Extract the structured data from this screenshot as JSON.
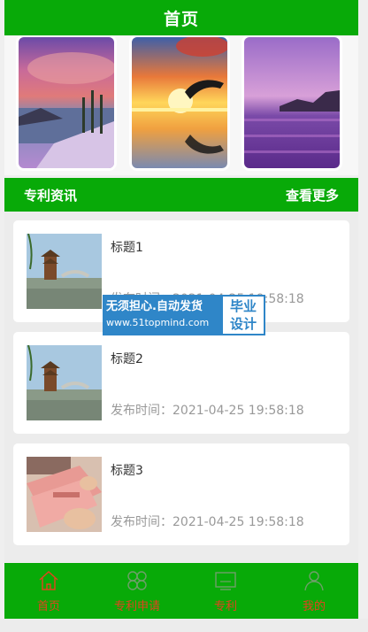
{
  "header": {
    "title": "首页"
  },
  "carousel": {
    "slides": [
      "sunset-lake-image",
      "dolphin-sunset-image",
      "purple-sea-image"
    ]
  },
  "section": {
    "title": "专利资讯",
    "more_label": "查看更多"
  },
  "articles": [
    {
      "title": "标题1",
      "time": "发布时间：2021-04-25 19:58:18",
      "thumb": "pagoda-image"
    },
    {
      "title": "标题2",
      "time": "发布时间：2021-04-25 19:58:18",
      "thumb": "pagoda-image"
    },
    {
      "title": "标题3",
      "time": "发布时间：2021-04-25 19:58:18",
      "thumb": "money-image"
    }
  ],
  "watermark": {
    "line1": "无须担心.自动发货",
    "line2": "www.51topmind.com",
    "side1": "毕业",
    "side2": "设计"
  },
  "tabbar": {
    "items": [
      {
        "label": "首页",
        "icon": "home-icon"
      },
      {
        "label": "专利申请",
        "icon": "clover-icon"
      },
      {
        "label": "专利",
        "icon": "monitor-icon"
      },
      {
        "label": "我的",
        "icon": "user-icon"
      }
    ]
  },
  "colors": {
    "primary": "#08aa08",
    "tab_label": "#e3431e",
    "watermark": "#2f86c8"
  }
}
